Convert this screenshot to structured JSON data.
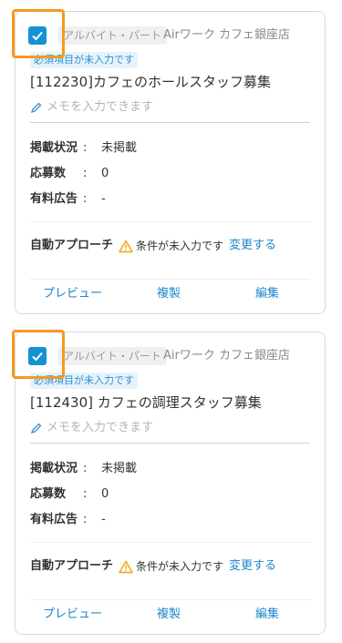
{
  "cards": [
    {
      "type_tag": "アルバイト・パート",
      "store": "Airワーク カフェ銀座店",
      "required_tag": "必須項目が未入力です",
      "title": "[112230]カフェのホールスタッフ募集",
      "memo_placeholder": "メモを入力できます",
      "status_label": "掲載状況",
      "status_value": "未掲載",
      "applications_label": "応募数",
      "applications_value": "0",
      "paid_ad_label": "有料広告",
      "paid_ad_value": "-",
      "approach_label": "自動アプローチ",
      "approach_warning": "条件が未入力です",
      "approach_change": "変更する",
      "preview": "プレビュー",
      "copy": "複製",
      "edit": "編集"
    },
    {
      "type_tag": "アルバイト・パート",
      "store": "Airワーク カフェ銀座店",
      "required_tag": "必須項目が未入力です",
      "title": "[112430] カフェの調理スタッフ募集",
      "memo_placeholder": "メモを入力できます",
      "status_label": "掲載状況",
      "status_value": "未掲載",
      "applications_label": "応募数",
      "applications_value": "0",
      "paid_ad_label": "有料広告",
      "paid_ad_value": "-",
      "approach_label": "自動アプローチ",
      "approach_warning": "条件が未入力です",
      "approach_change": "変更する",
      "preview": "プレビュー",
      "copy": "複製",
      "edit": "編集"
    }
  ],
  "colors": {
    "accent": "#1591d6",
    "link": "#1e87c8",
    "highlight": "#f39a1f",
    "warning": "#f0a500"
  },
  "icons": [
    "check-icon",
    "pencil-icon",
    "warning-icon"
  ]
}
